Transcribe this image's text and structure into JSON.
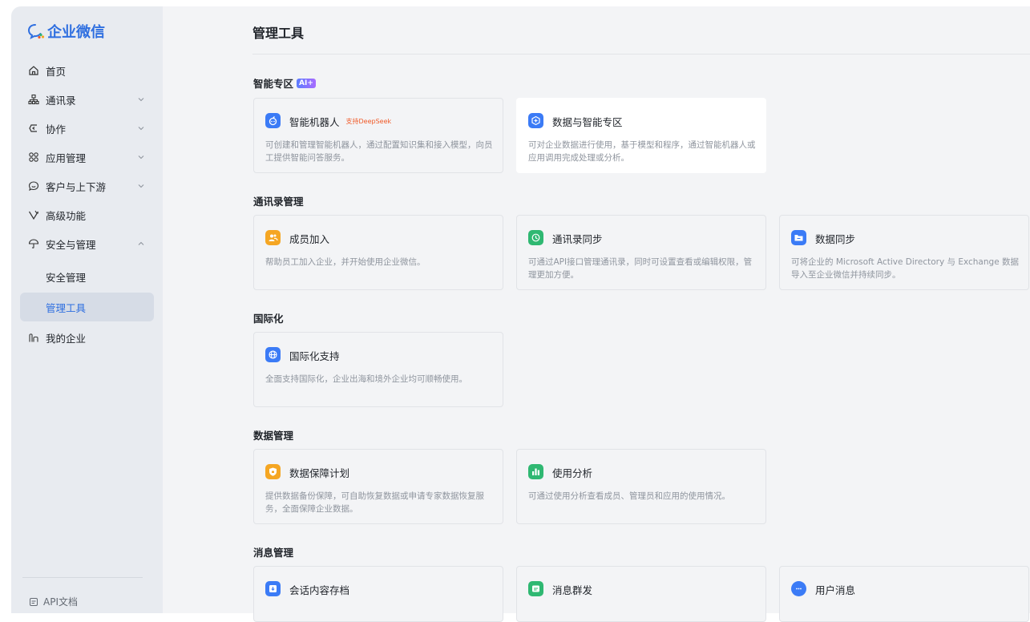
{
  "app": {
    "logo_text": "企业微信"
  },
  "sidebar": {
    "items": [
      {
        "label": "首页",
        "icon": "home-icon"
      },
      {
        "label": "通讯录",
        "icon": "org-chart-icon"
      },
      {
        "label": "协作",
        "icon": "collab-icon"
      },
      {
        "label": "应用管理",
        "icon": "apps-icon"
      },
      {
        "label": "客户与上下游",
        "icon": "chat-icon"
      },
      {
        "label": "高级功能",
        "icon": "advanced-icon"
      },
      {
        "label": "安全与管理",
        "icon": "umbrella-icon"
      },
      {
        "label": "安全管理"
      },
      {
        "label": "管理工具"
      },
      {
        "label": "我的企业",
        "icon": "enterprise-icon"
      }
    ],
    "api_doc": "API文档"
  },
  "main": {
    "title": "管理工具",
    "sections": [
      {
        "title": "智能专区",
        "badge": "AI+",
        "cards": [
          {
            "title": "智能机器人",
            "tag": "支持DeepSeek",
            "desc": "可创建和管理智能机器人，通过配置知识集和接入模型，向员工提供智能问答服务。",
            "icon": "robot-icon",
            "color": "#3b7bf6"
          },
          {
            "title": "数据与智能专区",
            "desc": "可对企业数据进行使用，基于模型和程序，通过智能机器人或应用调用完成处理或分析。",
            "icon": "data-ai-icon",
            "color": "#3b7bf6"
          }
        ]
      },
      {
        "title": "通讯录管理",
        "cards": [
          {
            "title": "成员加入",
            "desc": "帮助员工加入企业，并开始使用企业微信。",
            "icon": "members-icon",
            "color": "#f5a623"
          },
          {
            "title": "通讯录同步",
            "desc": "可通过API接口管理通讯录，同时可设置查看或编辑权限，管理更加方便。",
            "icon": "sync-icon",
            "color": "#2fb872"
          },
          {
            "title": "数据同步",
            "desc": "可将企业的 Microsoft Active Directory 与 Exchange 数据导入至企业微信并持续同步。",
            "icon": "folder-icon",
            "color": "#3b7bf6"
          }
        ]
      },
      {
        "title": "国际化",
        "cards": [
          {
            "title": "国际化支持",
            "desc": "全面支持国际化，企业出海和境外企业均可顺畅使用。",
            "icon": "globe-icon",
            "color": "#3b7bf6"
          }
        ]
      },
      {
        "title": "数据管理",
        "cards": [
          {
            "title": "数据保障计划",
            "desc": "提供数据备份保障，可自助恢复数据或申请专家数据恢复服务，全面保障企业数据。",
            "icon": "shield-icon",
            "color": "#f5a623"
          },
          {
            "title": "使用分析",
            "desc": "可通过使用分析查看成员、管理员和应用的使用情况。",
            "icon": "bar-chart-icon",
            "color": "#2fb872"
          }
        ]
      },
      {
        "title": "消息管理",
        "cards": [
          {
            "title": "会话内容存档",
            "icon": "archive-icon",
            "color": "#3b7bf6"
          },
          {
            "title": "消息群发",
            "icon": "broadcast-icon",
            "color": "#2fb872"
          },
          {
            "title": "用户消息",
            "icon": "message-icon",
            "color": "#3b7bf6"
          }
        ]
      }
    ]
  }
}
